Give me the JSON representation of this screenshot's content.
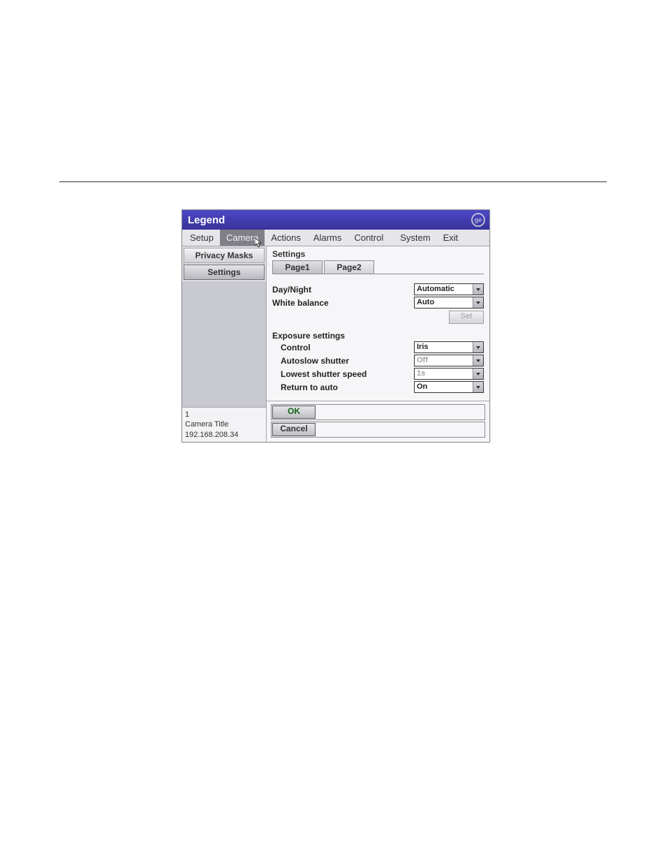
{
  "title": "Legend",
  "menu": [
    "Setup",
    "Camera",
    "Actions",
    "Alarms",
    "Control",
    "System",
    "Exit"
  ],
  "menuSelectedIndex": 1,
  "sidebar": {
    "items": [
      "Privacy Masks",
      "Settings"
    ],
    "selectedIndex": 1,
    "info": {
      "number": "1",
      "camTitle": "Camera Title",
      "ip": "192.168.208.34"
    }
  },
  "content": {
    "heading": "Settings",
    "pageTabs": [
      "Page1",
      "Page2"
    ],
    "activePageIndex": 1,
    "settings": {
      "dayNight": {
        "label": "Day/Night",
        "value": "Automatic"
      },
      "whiteBalance": {
        "label": "White balance",
        "value": "Auto"
      },
      "setBtn": "Set"
    },
    "exposure": {
      "heading": "Exposure settings",
      "control": {
        "label": "Control",
        "value": "Iris",
        "disabled": false
      },
      "autoslow": {
        "label": "Autoslow shutter",
        "value": "Off",
        "disabled": true
      },
      "lowest": {
        "label": "Lowest shutter speed",
        "value": "1s",
        "disabled": true
      },
      "returnAuto": {
        "label": "Return to auto",
        "value": "On",
        "disabled": false
      }
    }
  },
  "footer": {
    "ok": "OK",
    "cancel": "Cancel"
  }
}
